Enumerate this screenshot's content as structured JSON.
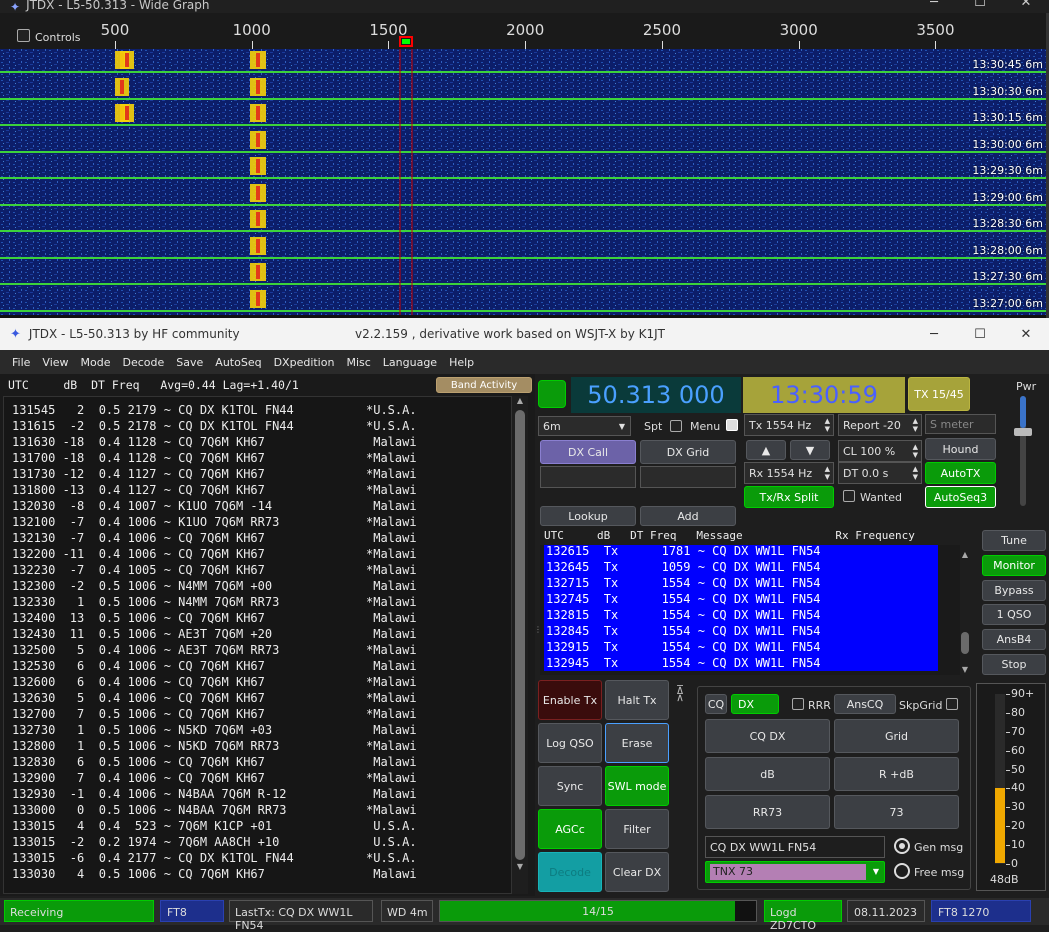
{
  "wide_graph": {
    "title": "JTDX - L5-50.313 - Wide Graph",
    "controls_label": "Controls",
    "ticks": [
      "500",
      "1000",
      "1500",
      "2000",
      "2500",
      "3000",
      "3500"
    ],
    "rows": [
      {
        "time": "13:30:45",
        "band": "6m"
      },
      {
        "time": "13:30:30",
        "band": "6m"
      },
      {
        "time": "13:30:15",
        "band": "6m"
      },
      {
        "time": "13:30:00",
        "band": "6m"
      },
      {
        "time": "13:29:30",
        "band": "6m"
      },
      {
        "time": "13:29:00",
        "band": "6m"
      },
      {
        "time": "13:28:30",
        "band": "6m"
      },
      {
        "time": "13:28:00",
        "band": "6m"
      },
      {
        "time": "13:27:30",
        "band": "6m"
      },
      {
        "time": "13:27:00",
        "band": "6m"
      }
    ]
  },
  "main": {
    "title": "JTDX - L5-50.313  by HF community",
    "subtitle": "v2.2.159 , derivative work based on WSJT-X by K1JT",
    "menu": [
      "File",
      "View",
      "Mode",
      "Decode",
      "Save",
      "AutoSeq",
      "DXpedition",
      "Misc",
      "Language",
      "Help"
    ],
    "band_header": "UTC     dB  DT Freq   Avg=0.44 Lag=+1.40/1",
    "band_activity_label": "Band Activity",
    "decodes": [
      "131545   2  0.5 2179 ~ CQ DX K1TOL FN44          *U.S.A.",
      "131615  -2  0.5 2178 ~ CQ DX K1TOL FN44          *U.S.A.",
      "131630 -18  0.4 1128 ~ CQ 7Q6M KH67               Malawi",
      "131700 -18  0.4 1128 ~ CQ 7Q6M KH67              *Malawi",
      "131730 -12  0.4 1127 ~ CQ 7Q6M KH67              *Malawi",
      "131800 -13  0.4 1127 ~ CQ 7Q6M KH67              *Malawi",
      "132030  -8  0.4 1007 ~ K1UO 7Q6M -14              Malawi",
      "132100  -7  0.4 1006 ~ K1UO 7Q6M RR73            *Malawi",
      "132130  -7  0.4 1006 ~ CQ 7Q6M KH67               Malawi",
      "132200 -11  0.4 1006 ~ CQ 7Q6M KH67              *Malawi",
      "132230  -7  0.4 1005 ~ CQ 7Q6M KH67              *Malawi",
      "132300  -2  0.5 1006 ~ N4MM 7Q6M +00              Malawi",
      "132330   1  0.5 1006 ~ N4MM 7Q6M RR73            *Malawi",
      "132400  13  0.5 1006 ~ CQ 7Q6M KH67               Malawi",
      "132430  11  0.5 1006 ~ AE3T 7Q6M +20              Malawi",
      "132500   5  0.4 1006 ~ AE3T 7Q6M RR73            *Malawi",
      "132530   6  0.4 1006 ~ CQ 7Q6M KH67               Malawi",
      "132600   6  0.4 1006 ~ CQ 7Q6M KH67              *Malawi",
      "132630   5  0.4 1006 ~ CQ 7Q6M KH67              *Malawi",
      "132700   7  0.5 1006 ~ CQ 7Q6M KH67              *Malawi",
      "132730   1  0.5 1006 ~ N5KD 7Q6M +03              Malawi",
      "132800   1  0.5 1006 ~ N5KD 7Q6M RR73            *Malawi",
      "132830   6  0.5 1006 ~ CQ 7Q6M KH67               Malawi",
      "132900   7  0.4 1006 ~ CQ 7Q6M KH67              *Malawi",
      "132930  -1  0.4 1006 ~ N4BAA 7Q6M R-12            Malawi",
      "133000   0  0.5 1006 ~ N4BAA 7Q6M RR73           *Malawi",
      "133015   4  0.4  523 ~ 7Q6M K1CP +01              U.S.A.",
      "133015  -2  0.2 1974 ~ 7Q6M AA8CH +10             U.S.A.",
      "133015  -6  0.4 2177 ~ CQ DX K1TOL FN44          *U.S.A.",
      "133030   4  0.5 1006 ~ CQ 7Q6M KH67               Malawi"
    ],
    "frequency": "50.313 000",
    "clock": "13:30:59",
    "tx_period": "TX 15/45",
    "pwr_label": "Pwr",
    "band_select": "6m",
    "spt_label": "Spt",
    "menu_label": "Menu",
    "tx_hz": "Tx  1554  Hz",
    "rx_hz": "Rx  1554  Hz",
    "report": "Report -20",
    "smeter_placeholder": "S meter",
    "cl": "CL  100 %",
    "dt": "DT 0.0 s",
    "hound": "Hound",
    "autotx": "AutoTX",
    "autoseq3": "AutoSeq3",
    "dx_call": "DX Call",
    "dx_grid": "DX Grid",
    "txrx_split": "Tx/Rx Split",
    "wanted": "Wanted",
    "lookup": "Lookup",
    "add": "Add",
    "rx_header": "UTC     dB   DT Freq   Message              Rx Frequency",
    "rx_lines": [
      "132615  Tx      1781 ~ CQ DX WW1L FN54",
      "132645  Tx      1059 ~ CQ DX WW1L FN54",
      "132715  Tx      1554 ~ CQ DX WW1L FN54",
      "132745  Tx      1554 ~ CQ DX WW1L FN54",
      "132815  Tx      1554 ~ CQ DX WW1L FN54",
      "132845  Tx      1554 ~ CQ DX WW1L FN54",
      "132915  Tx      1554 ~ CQ DX WW1L FN54",
      "132945  Tx      1554 ~ CQ DX WW1L FN54"
    ],
    "side_buttons": [
      "Tune",
      "Monitor",
      "Bypass",
      "1 QSO",
      "AnsB4",
      "Stop"
    ],
    "enable_tx": "Enable Tx",
    "halt_tx": "Halt Tx",
    "log_qso": "Log QSO",
    "erase": "Erase",
    "sync": "Sync",
    "swl_mode": "SWL mode",
    "agcc": "AGCc",
    "filter": "Filter",
    "decode": "Decode",
    "clear_dx": "Clear DX",
    "cq_label": "CQ",
    "dx_label": "DX",
    "rrr_label": "RRR",
    "anscq": "AnsCQ",
    "skpgrid": "SkpGrid",
    "msg_buttons": [
      "CQ DX",
      "Grid",
      "dB",
      "R +dB",
      "RR73",
      "73"
    ],
    "gen_msg_text": "CQ DX WW1L FN54",
    "gen_msg": "Gen msg",
    "free_msg_text": "TNX 73",
    "free_msg": "Free msg",
    "meter_scale": [
      "90+",
      "80",
      "70",
      "60",
      "50",
      "40",
      "30",
      "20",
      "10",
      "0"
    ],
    "meter_db": "48dB",
    "meter_level": 0.48
  },
  "status": {
    "receiving": "Receiving",
    "mode": "FT8",
    "last_tx": "LastTx: CQ DX WW1L FN54",
    "wd": "WD 4m",
    "progress_text": "14/15",
    "progress": 0.933,
    "logd": "Logd ZD7CTO",
    "date": "08.11.2023",
    "mode_freq": "FT8  1270"
  },
  "colors": {
    "accent_green": "#00b400",
    "freq_bg": "#0a3a3a",
    "freq_fg": "#4aa0ff",
    "clock_bg": "#a6a33a",
    "tx_blue": "#0000ff"
  }
}
